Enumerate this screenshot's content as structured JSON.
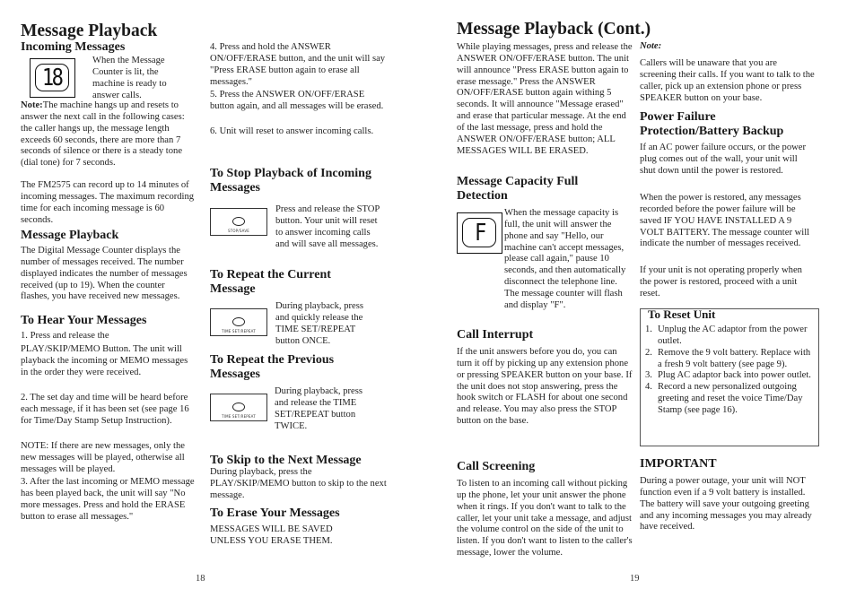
{
  "left_page": {
    "title": "Message Playback",
    "incoming": {
      "heading": "Incoming Messages",
      "counter_display": "18",
      "counter_text": "When the Message Counter is lit, the machine is ready to answer calls.",
      "note_label": "Note:",
      "note_text": "The machine hangs up and resets to answer the next call in the following cases: the caller hangs up, the message length exceeds 60 seconds, there are more than 7 seconds of silence or there is a steady tone (dial tone) for 7 seconds.",
      "capacity_text": "The FM2575 can record up to 14 minutes of incoming messages.  The maximum recording time for each incoming message is 60 seconds."
    },
    "playback": {
      "heading": "Message Playback",
      "text": "The Digital Message Counter displays the number of messages received.  The number displayed indicates the number of messages received (up to 19). When the counter flashes, you have received new messages."
    },
    "hear": {
      "heading": "To Hear Your Messages",
      "step1a": "1.  Press and release the",
      "step1b": "PLAY/SKIP/MEMO Button. The unit will playback the incoming or MEMO messages in the order they were received.",
      "step2": "2. The set day and time will be heard before each message, if it has been set (see page 16 for Time/Day Stamp Setup Instruction).",
      "note": "NOTE: If there are new messages, only the new messages will be played, otherwise all messages will be played.",
      "step3": "3. After the last incoming or MEMO message has been played back, the unit will say \"No more messages. Press and hold the ERASE button to erase all messages.\"",
      "step4": "4. Press and hold the ANSWER ON/OFF/ERASE button, and the unit will say \"Press ERASE button again to erase all messages.\"",
      "step5": "5. Press the ANSWER ON/OFF/ERASE button again, and all messages will be erased.",
      "step6": "6. Unit will reset to answer incoming calls."
    },
    "stop": {
      "heading": "To Stop Playback of Incoming Messages",
      "button_label": "STOP/SAVE",
      "text": "Press and release the STOP button. Your unit will reset to answer incoming calls and will save all messages."
    },
    "repeat_current": {
      "heading": "To Repeat the Current Message",
      "button_label": "TIME SET/REPEAT",
      "text": "During playback, press and quickly release the TIME SET/REPEAT button ONCE."
    },
    "repeat_previous": {
      "heading": "To Repeat the Previous Messages",
      "button_label": "TIME SET/REPEAT",
      "text": "During playback, press and release the TIME SET/REPEAT button TWICE."
    },
    "skip": {
      "heading": "To Skip to the Next Message",
      "text": "During playback, press the PLAY/SKIP/MEMO button to skip to the next message."
    },
    "erase": {
      "heading": "To Erase Your Messages",
      "text": "MESSAGES WILL BE SAVED UNLESS YOU ERASE THEM."
    },
    "page_number": "18"
  },
  "right_page": {
    "title": "Message Playback (Cont.)",
    "intro": "While playing messages, press and release the ANSWER ON/OFF/ERASE button. The unit will announce \"Press ERASE button again to erase message.\" Press the ANSWER ON/OFF/ERASE button again withing 5 seconds. It will announce \"Message erased\" and erase that particular message. At the end of the last message, press and hold the ANSWER ON/OFF/ERASE button; ALL MESSAGES WILL BE ERASED.",
    "capacity": {
      "heading": "Message Capacity Full Detection",
      "counter_display": "F",
      "text": "When the message capacity is full, the unit will answer the phone and say \"Hello, our machine can't accept messages, please call again,\" pause 10 seconds, and then automatically disconnect the telephone line.  The message counter  will flash and display \"F\"."
    },
    "interrupt": {
      "heading": "Call Interrupt",
      "text": "If the unit answers before you do, you can turn it off by picking up any extension phone or pressing SPEAKER button on your base. If the unit does not stop answering, press the hook switch or FLASH for about one second and release. You may also press the STOP button on the base."
    },
    "screening": {
      "heading": "Call Screening",
      "text": "To listen to an incoming call without picking up the phone, let your unit answer the phone when it rings. If you don't want to talk to the caller, let your unit take a message, and adjust the volume control on the side of the unit to listen. If you don't want to listen to the caller's message, lower the volume."
    },
    "note": {
      "label": "Note:",
      "text": "Callers will be unaware that you are screening their calls. If you want to talk to the caller, pick up an extension phone or press SPEAKER button on your base."
    },
    "power": {
      "heading": "Power Failure Protection/Battery Backup",
      "p1": "If an AC power failure occurs, or the power plug comes out of the wall, your unit will shut down until the power is restored.",
      "p2": "When the power is restored, any messages recorded before the power failure will be saved IF YOU HAVE INSTALLED A 9 VOLT BATTERY. The message counter will indicate the number of messages received.",
      "p3": "If your unit is not operating properly when the power is restored, proceed with a unit reset."
    },
    "reset": {
      "heading": "To Reset Unit",
      "steps": [
        {
          "num": "1.",
          "text": "Unplug the AC adaptor from the power outlet."
        },
        {
          "num": "2.",
          "text": "Remove the 9 volt battery.  Replace with a fresh 9 volt battery (see page 9)."
        },
        {
          "num": "3.",
          "text": "Plug AC adaptor back into power outlet."
        },
        {
          "num": "4.",
          "text": "Record a new personalized outgoing greeting and reset the voice Time/Day Stamp (see page 16)."
        }
      ]
    },
    "important": {
      "heading": "IMPORTANT",
      "text": "During a power outage, your unit will NOT function even if a 9 volt battery is installed. The battery will save your outgoing greeting and any incoming messages you may already have received."
    },
    "page_number": "19"
  }
}
